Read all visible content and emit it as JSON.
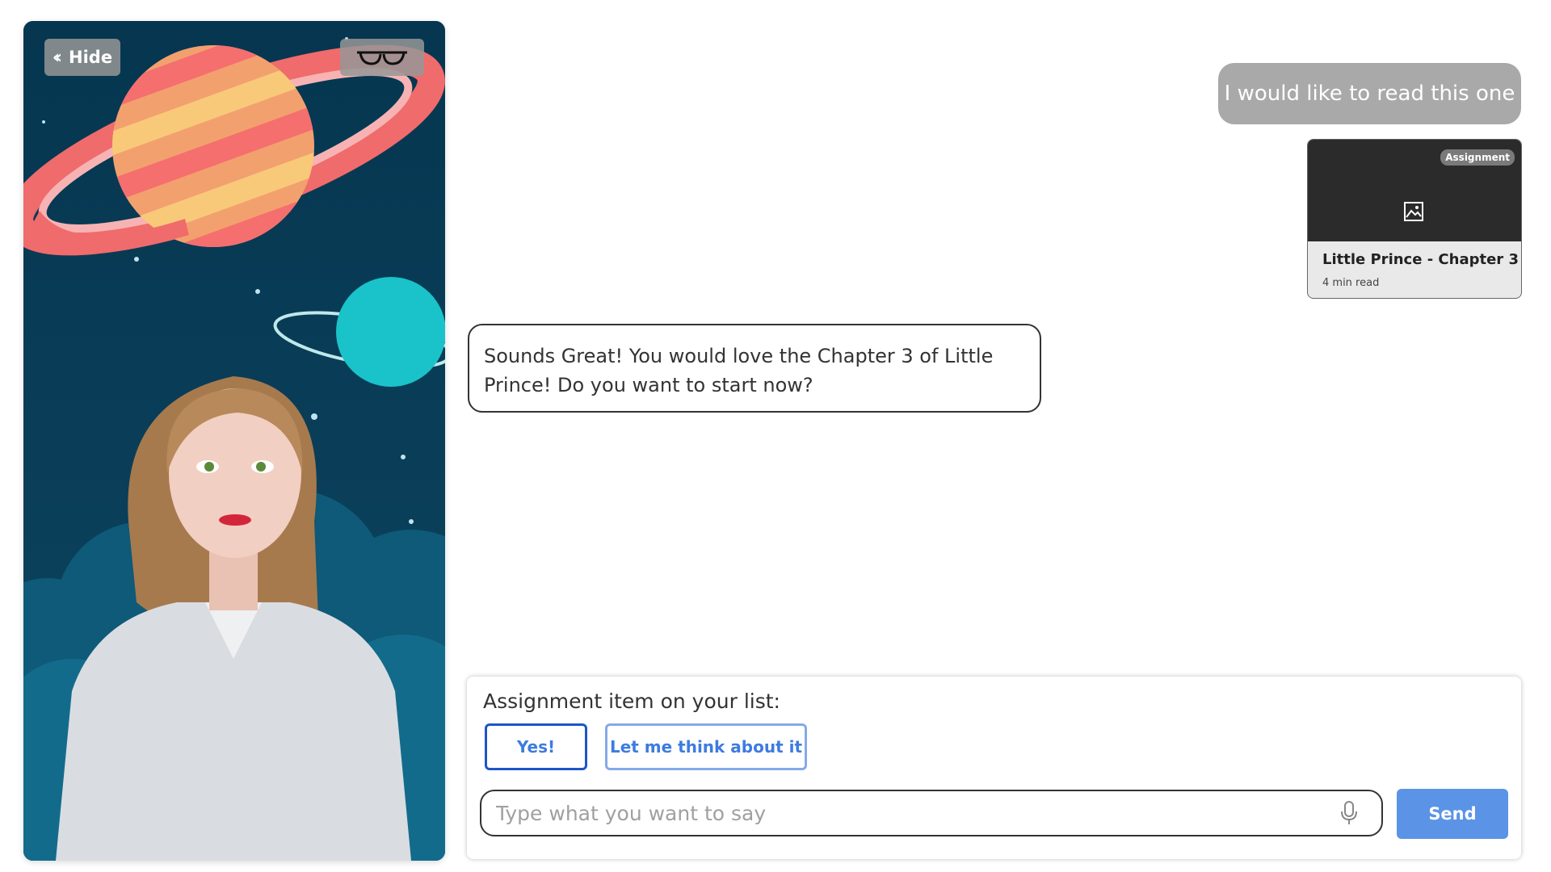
{
  "avatar_panel": {
    "hide_label": "Hide",
    "hide_icon": "chevrons-left-icon",
    "glasses_icon": "glasses-icon"
  },
  "chat": {
    "user_message": "I would like to read this one",
    "card": {
      "badge": "Assignment",
      "image_icon": "image-placeholder-icon",
      "title": "Little Prince - Chapter 3",
      "subtitle": "4 min read"
    },
    "bot_message": "Sounds Great! You would love the Chapter 3 of Little Prince! Do you want to start now?"
  },
  "composer": {
    "prompt": "Assignment item on your list:",
    "options": [
      "Yes!",
      "Let me think about it"
    ],
    "input_value": "",
    "input_placeholder": "Type what you want to say",
    "mic_icon": "microphone-icon",
    "send_label": "Send"
  },
  "colors": {
    "accent": "#5b94e6",
    "option_border_active": "#1e55c7",
    "user_bubble": "#a9a9a9",
    "scene_background": "#0b3d54"
  }
}
